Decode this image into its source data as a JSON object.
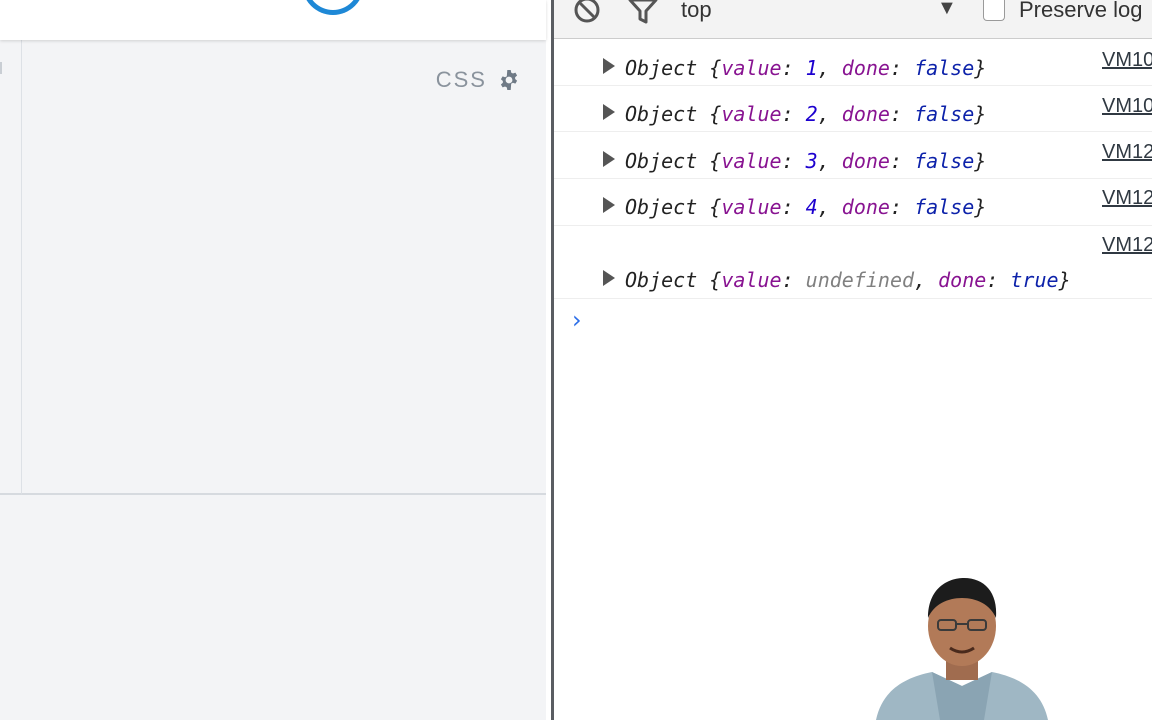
{
  "editor": {
    "panel_label": "CSS",
    "settings_icon": "gear-icon",
    "run_icon": "run-circle-icon"
  },
  "console": {
    "toolbar": {
      "clear_icon": "clear-console-icon",
      "filter_icon": "filter-icon",
      "context": "top",
      "dropdown_glyph": "▼",
      "preserve_log_label": "Preserve log",
      "preserve_log_checked": false
    },
    "entries": [
      {
        "prefix": "Object ",
        "open": "{",
        "key1": "value",
        "colon1": ": ",
        "val1": "1",
        "sep": ", ",
        "key2": "done",
        "colon2": ": ",
        "val2": "false",
        "close": "}",
        "source": "VM10"
      },
      {
        "prefix": "Object ",
        "open": "{",
        "key1": "value",
        "colon1": ": ",
        "val1": "2",
        "sep": ", ",
        "key2": "done",
        "colon2": ": ",
        "val2": "false",
        "close": "}",
        "source": "VM10"
      },
      {
        "prefix": "Object ",
        "open": "{",
        "key1": "value",
        "colon1": ": ",
        "val1": "3",
        "sep": ", ",
        "key2": "done",
        "colon2": ": ",
        "val2": "false",
        "close": "}",
        "source": "VM12"
      },
      {
        "prefix": "Object ",
        "open": "{",
        "key1": "value",
        "colon1": ": ",
        "val1": "4",
        "sep": ", ",
        "key2": "done",
        "colon2": ": ",
        "val2": "false",
        "close": "}",
        "source": "VM12"
      },
      {
        "prefix": "Object ",
        "open": "{",
        "key1": "value",
        "colon1": ": ",
        "val1": "undefined",
        "sep": ", ",
        "key2": "done",
        "colon2": ": ",
        "val2": "true",
        "close": "}",
        "source": "VM12"
      }
    ],
    "prompt": "›"
  },
  "colors": {
    "accent_blue": "#1e88d6",
    "key_purple": "#881391",
    "number_blue": "#1c00cf",
    "boolean_blue": "#0d22aa",
    "undefined_gray": "#808080",
    "prompt_blue": "#2c6ee8"
  }
}
